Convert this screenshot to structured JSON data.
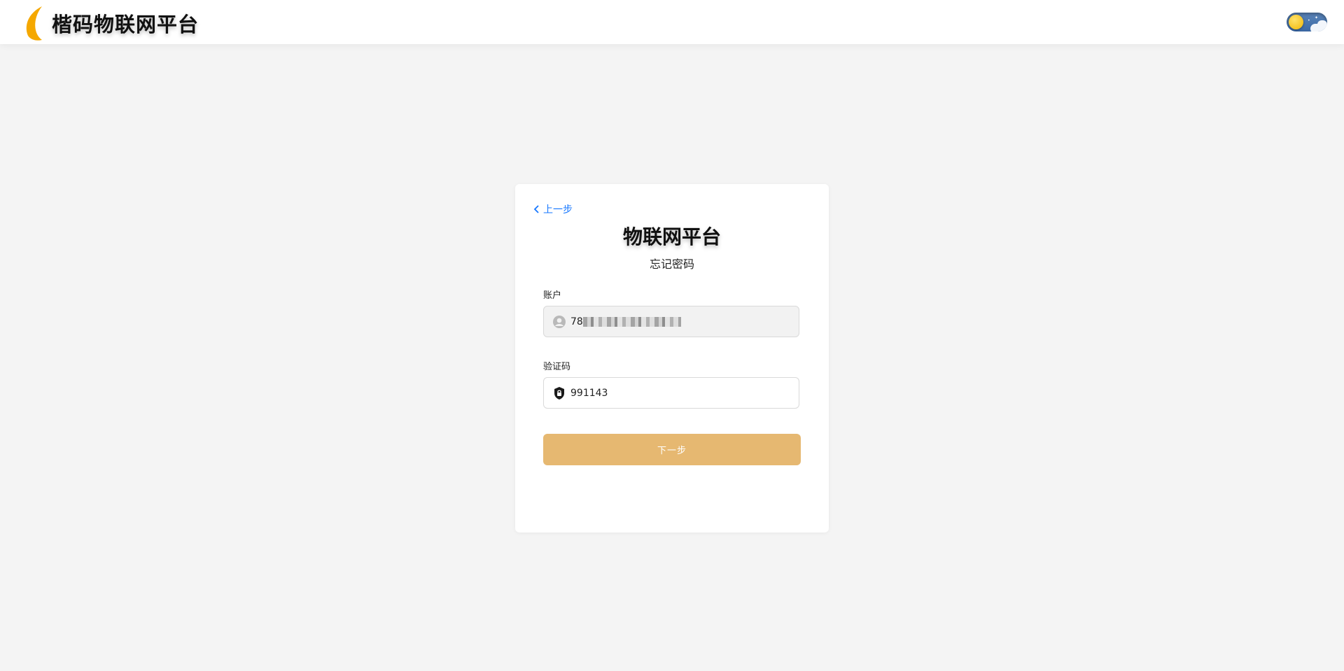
{
  "header": {
    "brand_title": "楷码物联网平台",
    "logo_icon": "crescent-moon-logo-icon",
    "logo_color": "#f5a800",
    "theme_toggle_icon": "sun-cloud-toggle-icon"
  },
  "form": {
    "back_label": "上一步",
    "back_icon": "chevron-left-icon",
    "title": "物联网平台",
    "subtitle": "忘记密码",
    "account": {
      "label": "账户",
      "value_prefix": "78",
      "icon": "user-circle-icon"
    },
    "code": {
      "label": "验证码",
      "value": "991143",
      "icon": "shield-lock-icon"
    },
    "next_label": "下一步"
  },
  "colors": {
    "accent_link": "#1677ff",
    "button": "#e6b871",
    "page_background": "#f4f4f4"
  }
}
